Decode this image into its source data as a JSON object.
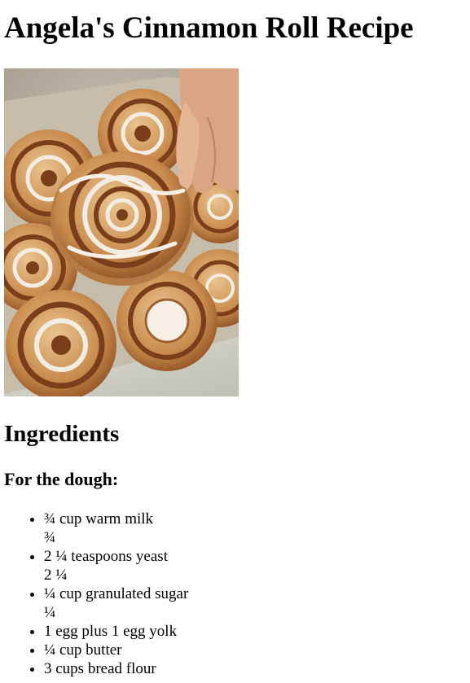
{
  "page": {
    "title": "Angela's Cinnamon Roll Recipe"
  },
  "photo": {
    "icon": "cinnamon-rolls-photo"
  },
  "ingredients": {
    "heading": "Ingredients",
    "dough_heading": "For the dough:",
    "items": [
      {
        "text": "¾ cup warm milk",
        "sub": "¾"
      },
      {
        "text": "2 ¼ teaspoons yeast",
        "sub": "2 ¼"
      },
      {
        "text": "¼ cup granulated sugar",
        "sub": "¼"
      },
      {
        "text": "1 egg plus 1 egg yolk",
        "sub": ""
      },
      {
        "text": "¼ cup butter",
        "sub": ""
      },
      {
        "text": "3 cups bread flour",
        "sub": ""
      }
    ]
  }
}
